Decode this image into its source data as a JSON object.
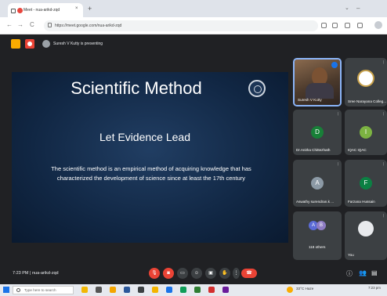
{
  "browser": {
    "tab_title": "Meet - nua-arikd-zqd",
    "close_glyph": "×",
    "new_tab_glyph": "+",
    "url": "https://meet.google.com/nua-arikd-zqd",
    "back_glyph": "←",
    "forward_glyph": "→",
    "reload_glyph": "C",
    "minimize_glyph": "–",
    "chevron_glyph": "⌄"
  },
  "meet": {
    "presenting_text": "Suresh V Kutty is presenting",
    "slide": {
      "title": "Scientific Method",
      "subtitle": "Let Evidence Lead",
      "body": "The scientific method is an empirical method of acquiring knowledge that has characterized the development of science since at least the 17th century"
    },
    "participants": [
      {
        "name": "Suresh V Kutty",
        "type": "video"
      },
      {
        "name": "Sree Narayana Colleg...",
        "type": "logo"
      },
      {
        "name": "Dr.Anitha Chittezhath",
        "initial": "D",
        "color": "#188038"
      },
      {
        "name": "IQAC IQAC",
        "initial": "I",
        "color": "#7cb342"
      },
      {
        "name": "Aswathy surendran.k ...",
        "initial": "A",
        "color": "#8c9aa6"
      },
      {
        "name": "Farzana Hussain",
        "initial": "F",
        "color": "#0b8043"
      },
      {
        "name": "118 others",
        "initials": [
          "A",
          "B"
        ]
      },
      {
        "name": "You",
        "type": "self"
      }
    ],
    "bottom": {
      "time": "7:23 PM",
      "separator": "|",
      "meeting_code": "nua-arikd-zqd"
    }
  },
  "taskbar": {
    "search_placeholder": "Type here to search",
    "weather": "33°C Haze",
    "time": "7:23 pm"
  },
  "colors": {
    "meet_bg": "#202124",
    "tile_bg": "#3c4043",
    "accent_blue": "#8ab4f8",
    "end_call_red": "#ea4335",
    "slide_bg": "#112744"
  }
}
